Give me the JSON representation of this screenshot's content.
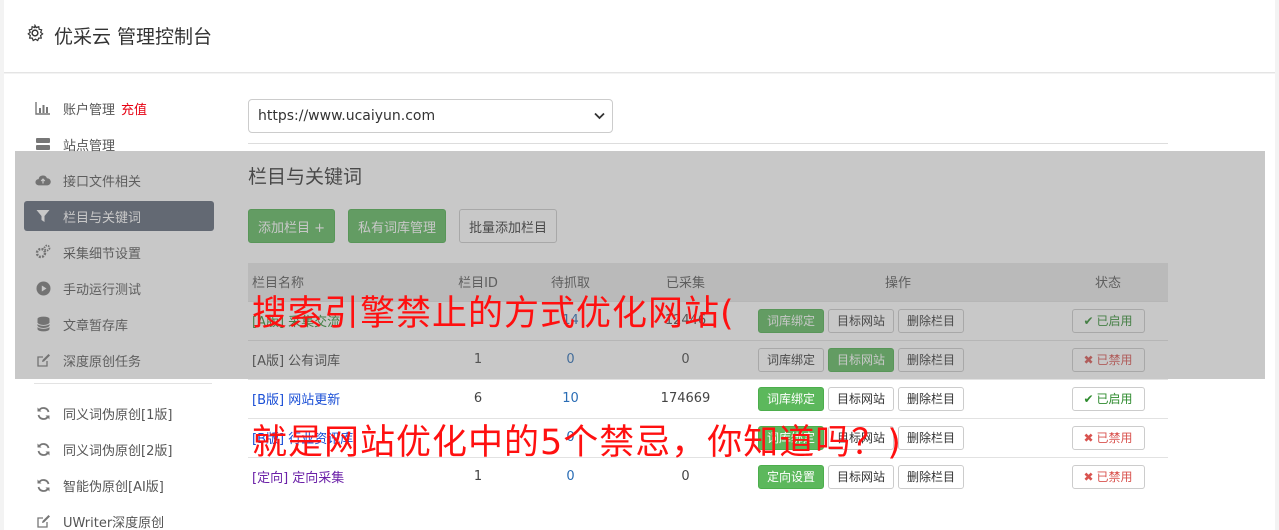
{
  "header": {
    "title": "优采云 管理控制台",
    "icon": "gear-icon"
  },
  "sidebar": {
    "items": [
      {
        "label": "账户管理",
        "icon": "bar-chart-icon",
        "extra": "充值"
      },
      {
        "label": "站点管理",
        "icon": "server-icon"
      },
      {
        "label": "接口文件相关",
        "icon": "cloud-upload-icon"
      },
      {
        "label": "栏目与关键词",
        "icon": "filter-icon",
        "active": true
      },
      {
        "label": "采集细节设置",
        "icon": "cogs-icon"
      },
      {
        "label": "手动运行测试",
        "icon": "play-circle-icon"
      },
      {
        "label": "文章暂存库",
        "icon": "database-icon"
      },
      {
        "label": "深度原创任务",
        "icon": "edit-icon"
      }
    ],
    "tools": [
      {
        "label": "同义词伪原创[1版]",
        "icon": "refresh-icon"
      },
      {
        "label": "同义词伪原创[2版]",
        "icon": "refresh-icon"
      },
      {
        "label": "智能伪原创[AI版]",
        "icon": "refresh-icon"
      },
      {
        "label": "UWriter深度原创",
        "icon": "edit-icon"
      }
    ]
  },
  "main": {
    "site_select": "https://www.ucaiyun.com",
    "section_title": "栏目与关键词",
    "buttons": {
      "add": "添加栏目 +",
      "private": "私有词库管理",
      "batch": "批量添加栏目"
    },
    "table": {
      "headers": [
        "栏目名称",
        "栏目ID",
        "待抓取",
        "已采集",
        "操作",
        "状态"
      ],
      "rows": [
        {
          "name": "[A版] 采集交流",
          "id": "",
          "pending": "14",
          "collected": "12446",
          "op1": "词库绑定",
          "op2": "目标网站",
          "op3": "删除栏目",
          "status": "已启用"
        },
        {
          "name": "[A版] 公有词库",
          "id": "1",
          "pending": "0",
          "collected": "0",
          "op1": "词库绑定",
          "op2": "目标网站",
          "op3": "删除栏目",
          "status": "已禁用"
        },
        {
          "name": "[B版] 网站更新",
          "id": "6",
          "pending": "10",
          "collected": "174669",
          "op1": "词库绑定",
          "op2": "目标网站",
          "op3": "删除栏目",
          "status": "已启用"
        },
        {
          "name": "[B版] 行业资讯库",
          "id": "",
          "pending": "0",
          "collected": "",
          "op1": "词库绑定",
          "op2": "目标网站",
          "op3": "删除栏目",
          "status": "已禁用"
        },
        {
          "name": "[定向] 定向采集",
          "id": "1",
          "pending": "0",
          "collected": "0",
          "op1": "定向设置",
          "op2": "目标网站",
          "op3": "删除栏目",
          "status": "已禁用"
        }
      ]
    }
  },
  "overlay": {
    "caption1": "搜索引擎禁止的方式优化网站(",
    "caption2": "就是网站优化中的5个禁忌，你知道吗？)"
  },
  "colors": {
    "accent": "#5cb85c",
    "active_nav": "#5d6677",
    "caption": "#ff1010",
    "danger": "#d9534f"
  }
}
